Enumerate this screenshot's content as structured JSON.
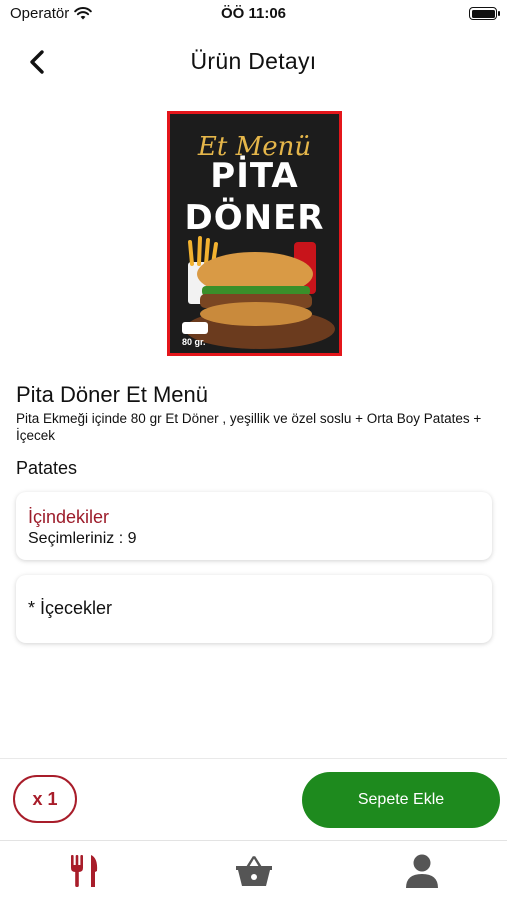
{
  "status_bar": {
    "carrier": "Operatör",
    "time": "ÖÖ 11:06"
  },
  "nav": {
    "title": "Ürün Detayı",
    "back_icon": "chevron-left-icon"
  },
  "product": {
    "image": {
      "script_text": "Et Menü",
      "line1": "PİTA",
      "line2": "DÖNER",
      "weight_label": "80 gr."
    },
    "name": "Pita Döner Et Menü",
    "description": "Pita Ekmeği içinde 80 gr Et Döner , yeşillik ve özel soslu + Orta Boy Patates + İçecek"
  },
  "section_title": "Patates",
  "options": {
    "ingredients": {
      "title": "İçindekiler",
      "subtitle": "Seçimleriniz : 9"
    },
    "drinks": {
      "title": "* İçecekler"
    }
  },
  "actions": {
    "quantity": "x 1",
    "add_to_cart": "Sepete Ekle"
  },
  "tabs": [
    {
      "name": "menu",
      "icon": "fork-knife-icon",
      "active": true
    },
    {
      "name": "cart",
      "icon": "basket-icon",
      "active": false
    },
    {
      "name": "profile",
      "icon": "user-icon",
      "active": false
    }
  ],
  "colors": {
    "accent_red": "#a81d2a",
    "add_button_green": "#1e8a1e",
    "inactive_icon": "#555555",
    "poster_border": "#e4161b"
  }
}
